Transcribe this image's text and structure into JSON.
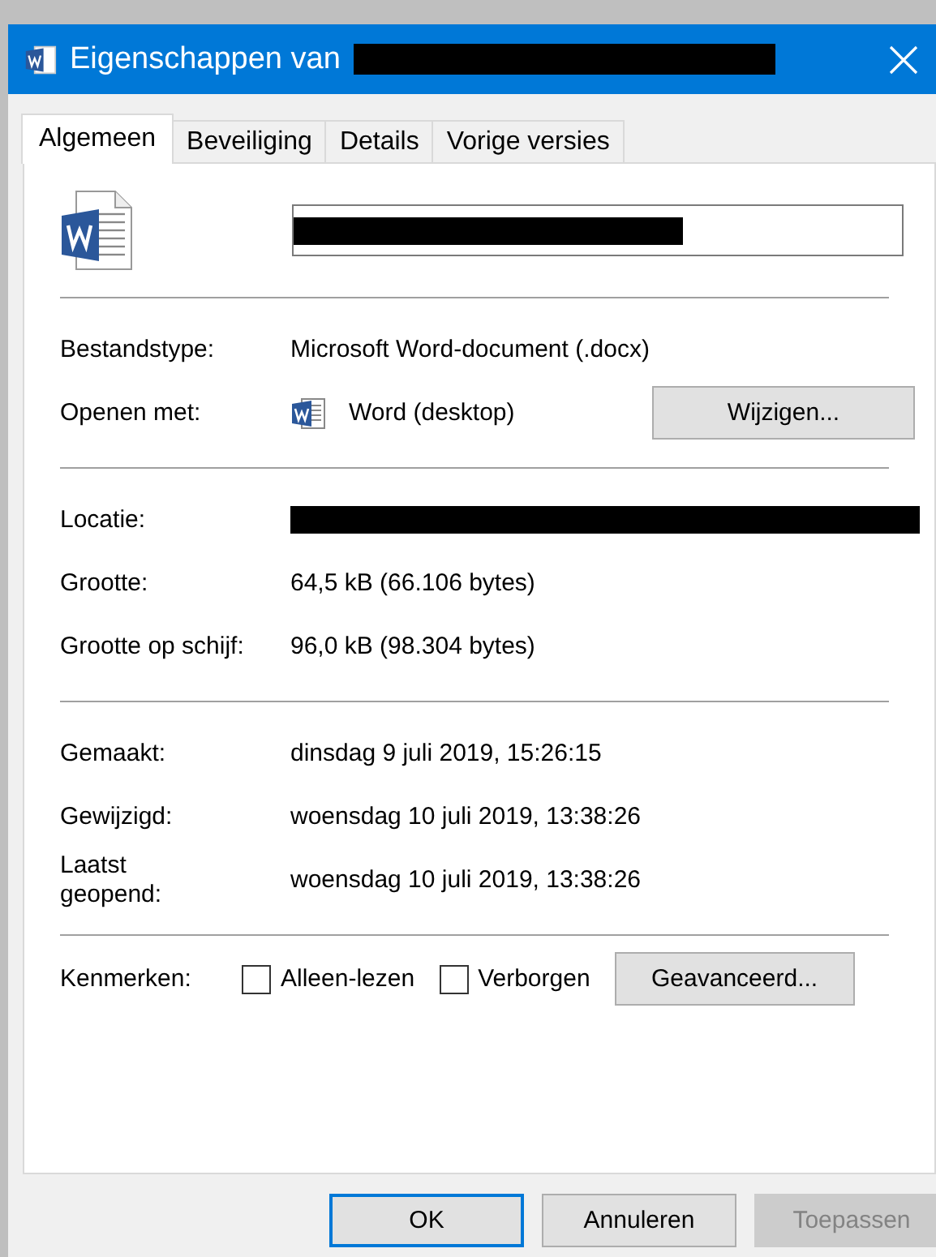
{
  "window": {
    "title": "Eigenschappen van",
    "title_redacted": true
  },
  "tabs": [
    {
      "label": "Algemeen",
      "selected": true
    },
    {
      "label": "Beveiliging",
      "selected": false
    },
    {
      "label": "Details",
      "selected": false
    },
    {
      "label": "Vorige versies",
      "selected": false
    }
  ],
  "file_name": {
    "redacted": true
  },
  "sections": [
    {
      "rows": [
        {
          "kind": "text",
          "label": "Bestandstype:",
          "value": "Microsoft Word-document (.docx)"
        },
        {
          "kind": "app",
          "label": "Openen met:",
          "value": "Word (desktop)",
          "button": "Wijzigen..."
        }
      ]
    },
    {
      "rows": [
        {
          "kind": "redacted",
          "label": "Locatie:"
        },
        {
          "kind": "text",
          "label": "Grootte:",
          "value": "64,5 kB (66.106 bytes)"
        },
        {
          "kind": "text",
          "label": "Grootte op schijf:",
          "value": "96,0 kB (98.304 bytes)"
        }
      ]
    },
    {
      "rows": [
        {
          "kind": "text",
          "label": "Gemaakt:",
          "value": "dinsdag 9 juli 2019, 15:26:15"
        },
        {
          "kind": "text",
          "label": "Gewijzigd:",
          "value": "woensdag 10 juli 2019, 13:38:26"
        },
        {
          "kind": "text",
          "label": "Laatst\ngeopend:",
          "value": "woensdag 10 juli 2019, 13:38:26"
        }
      ]
    }
  ],
  "attributes": {
    "label": "Kenmerken:",
    "checkboxes": [
      {
        "label": "Alleen-lezen",
        "checked": false
      },
      {
        "label": "Verborgen",
        "checked": false
      }
    ],
    "button": "Geavanceerd..."
  },
  "buttons": [
    {
      "label": "OK",
      "default": true,
      "disabled": false
    },
    {
      "label": "Annuleren",
      "default": false,
      "disabled": false
    },
    {
      "label": "Toepassen",
      "default": false,
      "disabled": true
    }
  ]
}
